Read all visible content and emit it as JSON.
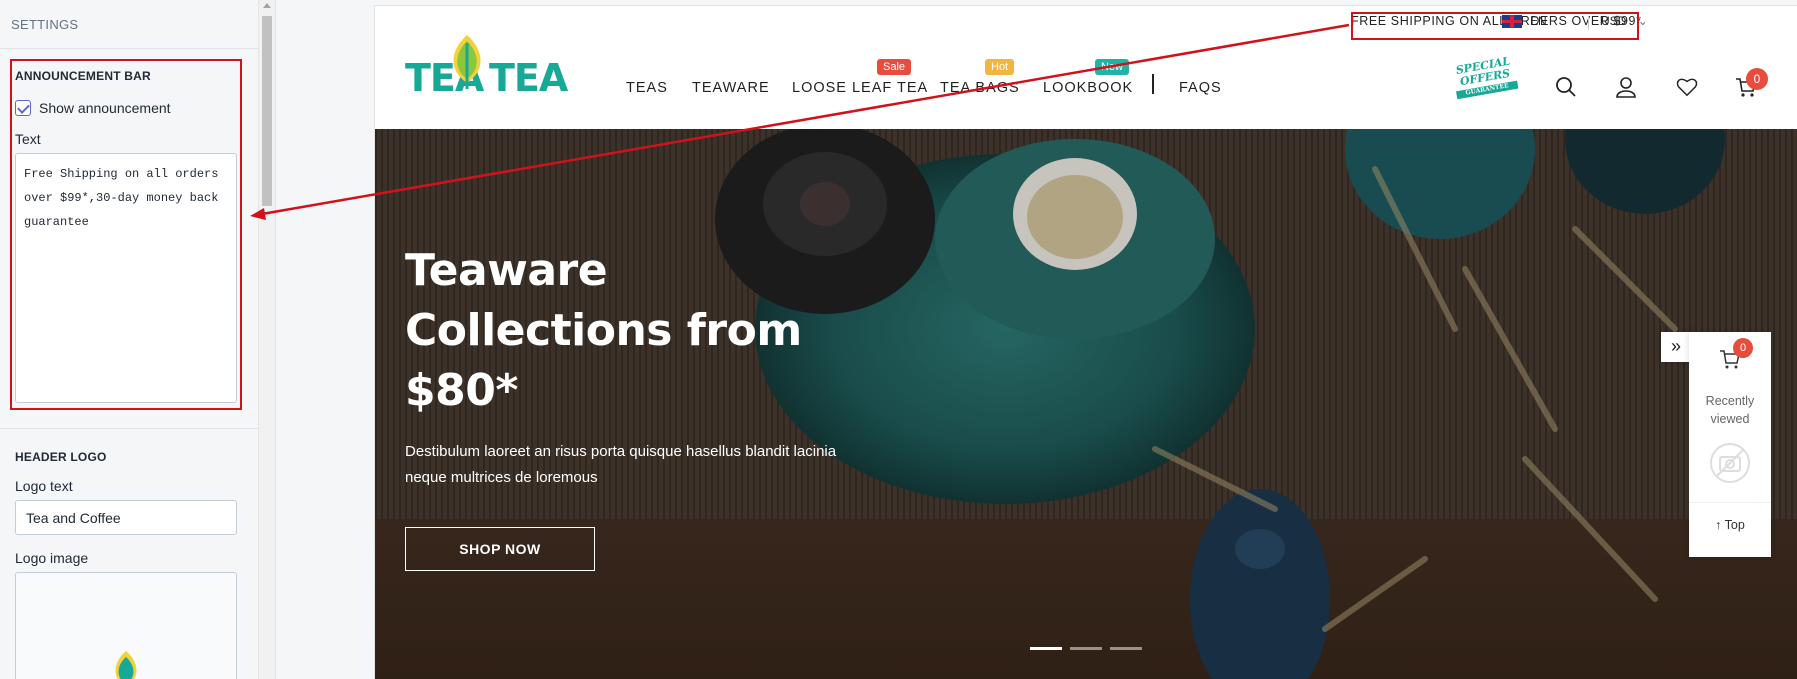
{
  "sidebar": {
    "title": "SETTINGS",
    "announcement": {
      "heading": "ANNOUNCEMENT BAR",
      "show_label": "Show announcement",
      "text_label": "Text",
      "text_value": "Free Shipping on all orders over $99*,30-day money back guarantee"
    },
    "header_logo": {
      "heading": "HEADER LOGO",
      "logo_text_label": "Logo text",
      "logo_text_value": "Tea and Coffee",
      "logo_image_label": "Logo image"
    }
  },
  "store": {
    "logo": {
      "left": "TEA",
      "right": "TEA"
    },
    "announcement": "FREE SHIPPING ON ALL ORDERS OVER $99*",
    "language": "EN",
    "currency": "USD",
    "nav": [
      {
        "label": "TEAS"
      },
      {
        "label": "TEAWARE"
      },
      {
        "label": "LOOSE LEAF TEA",
        "badge": "Sale"
      },
      {
        "label": "TEA BAGS",
        "badge": "Hot"
      },
      {
        "label": "LOOKBOOK",
        "badge": "New"
      },
      {
        "label": "FAQS"
      }
    ],
    "special_offers": {
      "line1": "SPECIAL",
      "line2": "OFFERS",
      "ribbon": "GUARANTEE"
    },
    "cart_count": "0",
    "hero": {
      "title": "Teaware Collections from $80*",
      "description": "Destibulum laoreet an risus porta quisque hasellus blandit lacinia neque multrices de loremous",
      "button": "SHOP NOW"
    },
    "widget": {
      "cart_count": "0",
      "recently_viewed": "Recently viewed",
      "top": "Top"
    }
  },
  "colors": {
    "brand": "#18a896",
    "badge_sale": "#e74c3c",
    "badge_hot": "#f2b53d",
    "badge_new": "#1fb5a6",
    "annotation": "#d0121b"
  }
}
